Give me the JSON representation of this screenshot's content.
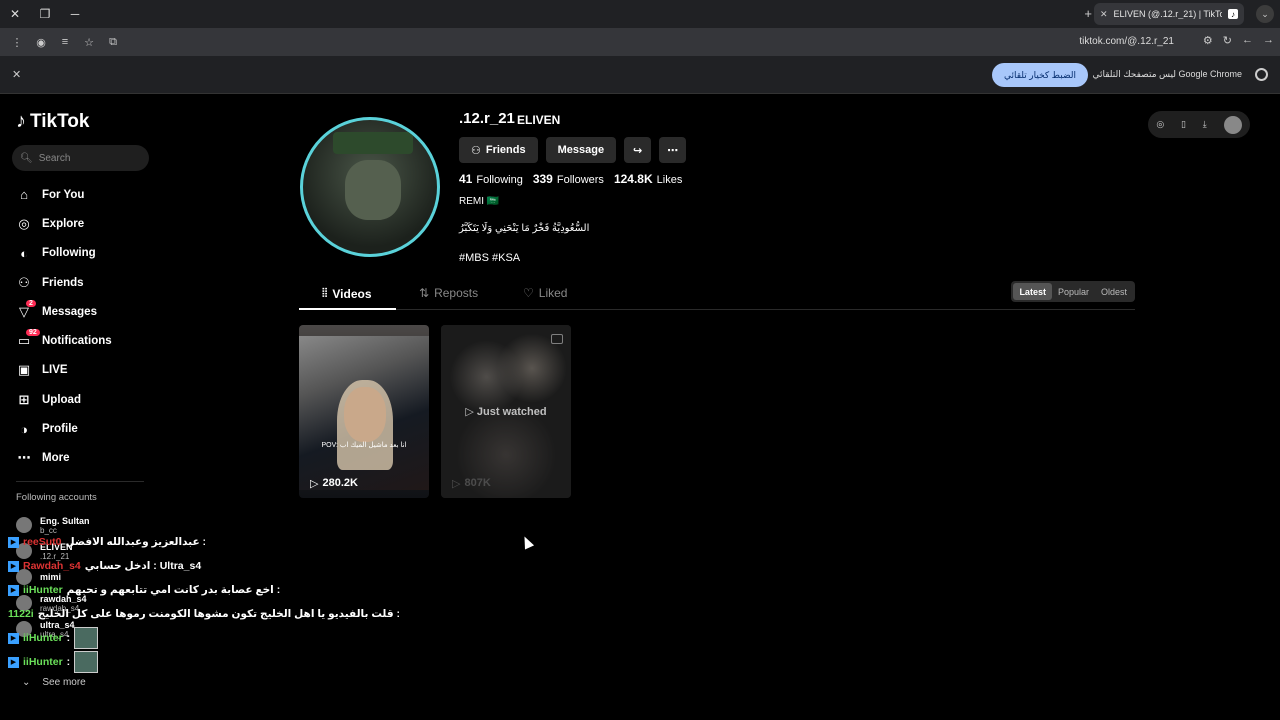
{
  "browser": {
    "tab_title": "ELIVEN (@.12.r_21) | TikTok",
    "url": "tiktok.com/@.12.r_21",
    "infobar_button": "الضبط كخيار تلقائي",
    "infobar_message": "Google Chrome ليس متصفحك التلقائي"
  },
  "brand": {
    "name": "TikTok"
  },
  "search": {
    "placeholder": "Search"
  },
  "nav": [
    {
      "label": "For You",
      "icon": "home-icon"
    },
    {
      "label": "Explore",
      "icon": "compass-icon"
    },
    {
      "label": "Following",
      "icon": "following-avatar-icon"
    },
    {
      "label": "Friends",
      "icon": "friends-icon"
    },
    {
      "label": "Messages",
      "icon": "messages-icon",
      "badge": "2"
    },
    {
      "label": "Notifications",
      "icon": "bell-icon",
      "badge": "92"
    },
    {
      "label": "LIVE",
      "icon": "live-icon"
    },
    {
      "label": "Upload",
      "icon": "upload-icon"
    },
    {
      "label": "Profile",
      "icon": "profile-icon"
    },
    {
      "label": "More",
      "icon": "more-icon"
    }
  ],
  "following_accounts": {
    "title": "Following accounts",
    "items": [
      {
        "name": "Eng. Sultan",
        "handle": "b_cc"
      },
      {
        "name": "ELIVEN",
        "handle": ".12.r_21"
      },
      {
        "name": "mimi",
        "handle": ""
      },
      {
        "name": "rawdah_s4",
        "handle": "rawdah_s4"
      },
      {
        "name": "ultra_s4",
        "handle": "ultra_s4"
      }
    ],
    "see_more": "See more"
  },
  "overlay_chat": [
    {
      "user": "reeSut0",
      "text": "عبدالعزيز وعبدالله الافضل :",
      "color": "u1"
    },
    {
      "user": "Rawdah_s4",
      "text": "ادخل حسابي : Ultra_s4",
      "color": "u1"
    },
    {
      "user": "iiHunter",
      "text": "اخع عصابة بدر كانت امي تتابعهم و تحبهم :",
      "color": "u2"
    },
    {
      "user": "1122i",
      "text": "قلت بالفيديو يا اهل الخليج تكون مشوها الكومنت رموها على كل الخليج :",
      "color": "u2"
    },
    {
      "user": "iiHunter",
      "text": ":",
      "color": "u2"
    },
    {
      "user": "iiHunter",
      "text": ":",
      "color": "u2"
    }
  ],
  "profile": {
    "username": ".12.r_21",
    "nickname": "ELIVEN",
    "buttons": {
      "friends": "Friends",
      "message": "Message"
    },
    "stats": [
      {
        "value": "41",
        "label": "Following"
      },
      {
        "value": "339",
        "label": "Followers"
      },
      {
        "value": "124.8K",
        "label": "Likes"
      }
    ],
    "bio_line1": "REMI 🇸🇦",
    "bio_line2": "السُّعُودِيَّةُ فَخْرٌ مَا يَنْحَنِي وَلَا يَتَكَبَّرُ",
    "tags": "#MBS #KSA"
  },
  "tabs": [
    {
      "label": "Videos",
      "icon": "grid-icon"
    },
    {
      "label": "Reposts",
      "icon": "repost-icon"
    },
    {
      "label": "Liked",
      "icon": "heart-icon"
    }
  ],
  "sort": [
    "Latest",
    "Popular",
    "Oldest"
  ],
  "videos": [
    {
      "views": "280.2K",
      "caption": "POV: انا بعد ماشيل الميك اب"
    },
    {
      "views": "807K",
      "overlay": "Just watched"
    }
  ]
}
